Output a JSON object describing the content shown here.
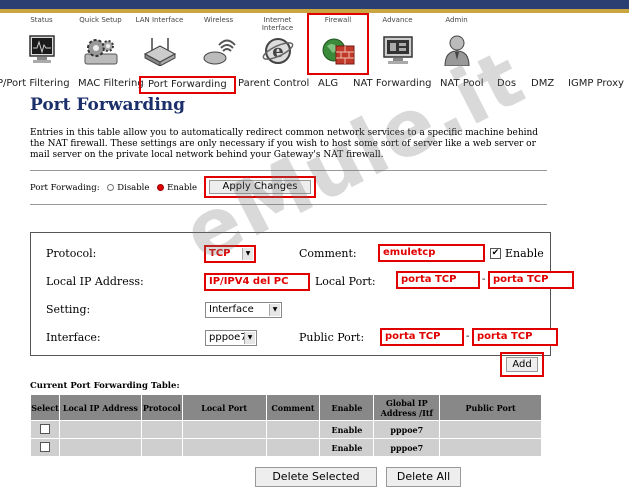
{
  "nav": {
    "items": [
      {
        "label": "Status",
        "icon": "monitor-icon"
      },
      {
        "label": "Quick Setup",
        "icon": "gears-icon"
      },
      {
        "label": "LAN Interface",
        "icon": "router-icon"
      },
      {
        "label": "Wireless",
        "icon": "wireless-icon"
      },
      {
        "label": "Internet Interface",
        "icon": "internet-icon"
      },
      {
        "label": "Firewall",
        "icon": "firewall-icon"
      },
      {
        "label": "Advance",
        "icon": "advance-icon"
      },
      {
        "label": "Admin",
        "icon": "admin-icon"
      }
    ],
    "active": "Firewall"
  },
  "subnav": {
    "items": [
      "IP/Port Filtering",
      "MAC Filtering",
      "Port Forwarding",
      "Parent Control",
      "ALG",
      "NAT Forwarding",
      "NAT Pool",
      "Dos",
      "DMZ",
      "IGMP Proxy"
    ],
    "active": "Port Forwarding"
  },
  "page": {
    "title": "Port Forwarding",
    "intro": "Entries in this table allow you to automatically redirect common network services to a specific machine behind the NAT firewall. These settings are only necessary if you wish to host some sort of server like a web server or mail server on the private local network behind your Gateway's NAT firewall."
  },
  "port_forwarding": {
    "label": "Port Forwading:",
    "disable_label": "Disable",
    "enable_label": "Enable",
    "selected": "Enable",
    "apply_label": "Apply Changes"
  },
  "form": {
    "protocol_label": "Protocol:",
    "protocol_value": "TCP",
    "comment_label": "Comment:",
    "comment_value": "emuletcp",
    "enable_label": "Enable",
    "enable_checked": true,
    "enable_check_mark": "✔",
    "local_ip_label": "Local IP Address:",
    "local_ip_value": "IP/IPV4 del PC",
    "local_port_label": "Local Port:",
    "local_port_from": "porta TCP",
    "local_port_to": "porta TCP",
    "port_dash": "-",
    "setting_label": "Setting:",
    "setting_value": "Interface",
    "interface_label": "Interface:",
    "interface_value": "pppoe7",
    "public_port_label": "Public Port:",
    "public_port_from": "porta TCP",
    "public_port_to": "porta TCP",
    "add_label": "Add",
    "select_arrow": "▼"
  },
  "table": {
    "title": "Current Port Forwarding Table:",
    "headers": [
      "Select",
      "Local IP Address",
      "Protocol",
      "Local Port",
      "Comment",
      "Enable",
      "Global IP Address /Itf",
      "Public Port"
    ],
    "rows": [
      {
        "enable": "Enable",
        "itf": "pppoe7"
      },
      {
        "enable": "Enable",
        "itf": "pppoe7"
      }
    ]
  },
  "buttons": {
    "delete_selected": "Delete Selected",
    "delete_all": "Delete All"
  },
  "watermark": "eMule.it",
  "colors": {
    "highlight": "#e00000",
    "title": "#1b2f6a",
    "table_header": "#888888",
    "table_cell": "#cfcfcf"
  }
}
